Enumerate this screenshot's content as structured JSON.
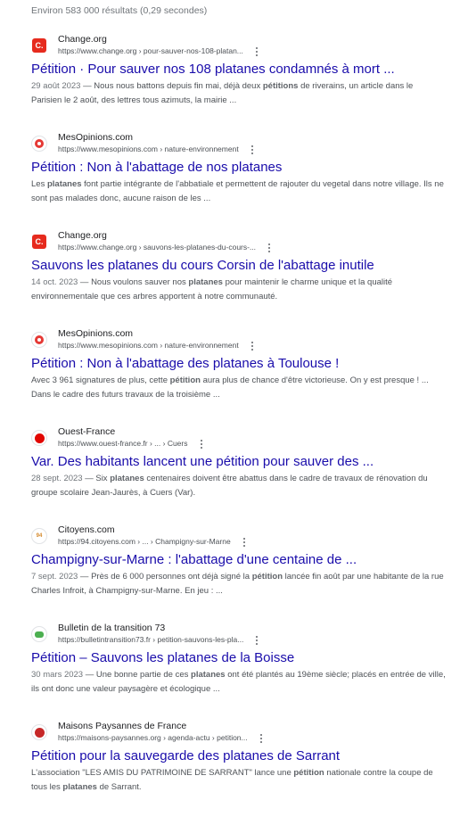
{
  "stats": "Environ 583 000 résultats (0,29 secondes)",
  "results": [
    {
      "favicon": "change-org-favicon",
      "site": "Change.org",
      "url": "https://www.change.org › pour-sauver-nos-108-platan...",
      "title": "Pétition · Pour sauver nos 108 platanes condamnés à mort ...",
      "date": "29 août 2023",
      "snippet": [
        {
          "t": " — Nous nous battons depuis fin mai, déjà deux "
        },
        {
          "t": "pétitions",
          "b": true
        },
        {
          "t": " de riverains, un article dans le Parisien le 2 août, des lettres tous azimuts, la mairie ..."
        }
      ]
    },
    {
      "favicon": "mesopinions-favicon",
      "site": "MesOpinions.com",
      "url": "https://www.mesopinions.com › nature-environnement",
      "title": "Pétition : Non à l'abattage de nos platanes",
      "date": "",
      "snippet": [
        {
          "t": "Les "
        },
        {
          "t": "platanes",
          "b": true
        },
        {
          "t": " font partie intégrante de l'abbatiale et permettent de rajouter du vegetal dans notre village. Ils ne sont pas malades donc, aucune raison de les ..."
        }
      ]
    },
    {
      "favicon": "change-org-favicon",
      "site": "Change.org",
      "url": "https://www.change.org › sauvons-les-platanes-du-cours-...",
      "title": "Sauvons les platanes du cours Corsin de l'abattage inutile",
      "date": "14 oct. 2023",
      "snippet": [
        {
          "t": " — Nous voulons sauver nos "
        },
        {
          "t": "platanes",
          "b": true
        },
        {
          "t": " pour maintenir le charme unique et la qualité environnementale que ces arbres apportent à notre communauté."
        }
      ]
    },
    {
      "favicon": "mesopinions-favicon",
      "site": "MesOpinions.com",
      "url": "https://www.mesopinions.com › nature-environnement",
      "title": "Pétition : Non à l'abattage des platanes à Toulouse !",
      "date": "",
      "snippet": [
        {
          "t": "Avec 3 961 signatures de plus, cette "
        },
        {
          "t": "pétition",
          "b": true
        },
        {
          "t": " aura plus de chance d'être victorieuse. On y est presque ! ... Dans le cadre des futurs travaux de la troisième ..."
        }
      ]
    },
    {
      "favicon": "ouest-france-favicon",
      "site": "Ouest-France",
      "url": "https://www.ouest-france.fr › ... › Cuers",
      "title": "Var. Des habitants lancent une pétition pour sauver des ...",
      "date": "28 sept. 2023",
      "snippet": [
        {
          "t": " — Six "
        },
        {
          "t": "platanes",
          "b": true
        },
        {
          "t": " centenaires doivent être abattus dans le cadre de travaux de rénovation du groupe scolaire Jean-Jaurès, à Cuers (Var)."
        }
      ]
    },
    {
      "favicon": "citoyens-favicon",
      "site": "Citoyens.com",
      "url": "https://94.citoyens.com › ... › Champigny-sur-Marne",
      "title": "Champigny-sur-Marne : l'abattage d'une centaine de ...",
      "date": "7 sept. 2023",
      "snippet": [
        {
          "t": " — Près de 6 000 personnes ont déjà signé la "
        },
        {
          "t": "pétition",
          "b": true
        },
        {
          "t": " lancée fin août par une habitante de la rue Charles Infroit, à Champigny-sur-Marne. En jeu : ..."
        }
      ]
    },
    {
      "favicon": "bulletin-favicon",
      "site": "Bulletin de la transition 73",
      "url": "https://bulletintransition73.fr › petition-sauvons-les-pla...",
      "title": "Pétition – Sauvons les platanes de la Boisse",
      "date": "30 mars 2023",
      "snippet": [
        {
          "t": " — Une bonne partie de ces "
        },
        {
          "t": "platanes",
          "b": true
        },
        {
          "t": " ont été plantés au 19ème siècle; placés en entrée de ville, ils ont donc une valeur paysagère et écologique ..."
        }
      ]
    },
    {
      "favicon": "maisons-paysannes-favicon",
      "site": "Maisons Paysannes de France",
      "url": "https://maisons-paysannes.org › agenda-actu › petition...",
      "title": "Pétition pour la sauvegarde des platanes de Sarrant",
      "date": "",
      "snippet": [
        {
          "t": "L'association \"LES AMIS DU PATRIMOINE DE SARRANT\" lance une "
        },
        {
          "t": "pétition",
          "b": true
        },
        {
          "t": " nationale contre la coupe de tous les "
        },
        {
          "t": "platanes",
          "b": true
        },
        {
          "t": " de Sarrant."
        }
      ]
    }
  ],
  "favicon_letters": {
    "change": "C.",
    "citoyens": "94"
  }
}
